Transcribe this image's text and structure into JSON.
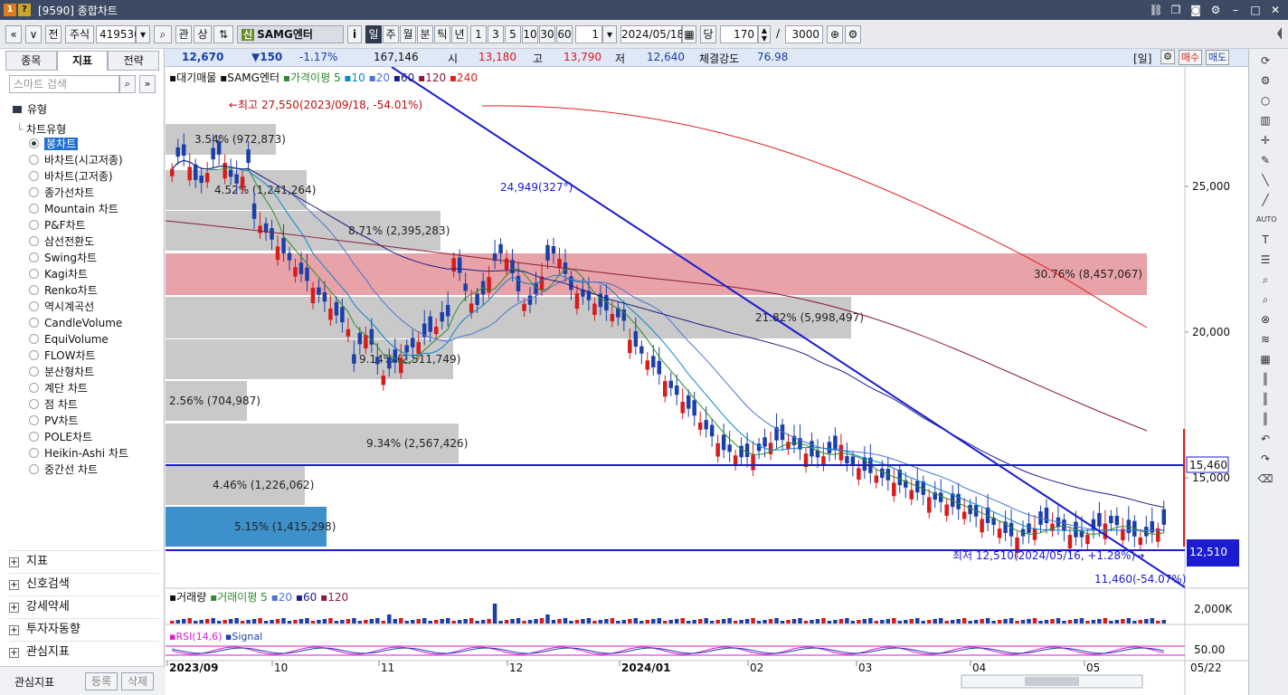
{
  "window": {
    "title": "[9590] 종합차트",
    "icons": [
      "settings-icon",
      "help-icon"
    ]
  },
  "toolbar": {
    "market": "주식",
    "code": "419530",
    "kwan": "관",
    "sang": "상",
    "name_badge": "신",
    "name": "SAMG엔터",
    "info": "i",
    "periods": [
      "일",
      "주",
      "월",
      "분",
      "틱",
      "년"
    ],
    "active_period": "일",
    "intervals": [
      "1",
      "3",
      "5",
      "10",
      "30",
      "60"
    ],
    "unit": "1",
    "date": "2024/05/18",
    "count_label": "당",
    "count": "170",
    "slash": "/",
    "total": "3000",
    "jeon": "전"
  },
  "left": {
    "tabs": [
      "종목",
      "지표",
      "전략"
    ],
    "active_tab": "지표",
    "search_placeholder": "스마트 검색",
    "tree_root": "유형",
    "tree_sub": "차트유형",
    "chart_types": [
      "봉차트",
      "바차트(시고저종)",
      "바차트(고저종)",
      "종가선차트",
      "Mountain 차트",
      "P&F차트",
      "삼선전환도",
      "Swing차트",
      "Kagi차트",
      "Renko차트",
      "역시계곡선",
      "CandleVolume",
      "EquiVolume",
      "FLOW차트",
      "분산형차트",
      "계단 차트",
      "점 차트",
      "PV차트",
      "POLE차트",
      "Heikin-Ashi 차트",
      "중간선 차트"
    ],
    "selected": "봉차트",
    "sections": [
      "지표",
      "신호검색",
      "강세약세",
      "투자자동향",
      "관심지표"
    ],
    "footer": {
      "label": "관심지표",
      "register": "등록",
      "delete": "삭제"
    }
  },
  "pricebar": {
    "price": "12,670",
    "change": "▼150",
    "pct": "-1.17%",
    "volume": "167,146",
    "open_label": "시",
    "open": "13,180",
    "high_label": "고",
    "high": "13,790",
    "low_label": "저",
    "low": "12,640",
    "strength_label": "체결강도",
    "strength": "76.98",
    "period_tag": "[일]",
    "buy": "매수",
    "sell": "매도"
  },
  "chart": {
    "legend": {
      "vp": "대기매물",
      "name": "SAMG엔터",
      "ma_label": "가격이평",
      "ma": [
        "5",
        "10",
        "20",
        "60",
        "120",
        "240"
      ]
    },
    "annotations": {
      "high": "←최고 27,550(2023/09/18, -54.01%)",
      "point": "24,949(327°)",
      "low": "최저 12,510(2024/05/16, +1.28%)→",
      "target": "11,460(-54.07%)"
    },
    "volume_profile": [
      {
        "label": "3.54% (972,873)"
      },
      {
        "label": "4.52% (1,241,264)"
      },
      {
        "label": "8.71% (2,395,283)"
      },
      {
        "label": "30.76% (8,457,067)"
      },
      {
        "label": "21.82% (5,998,497)"
      },
      {
        "label": "9.14% (2,511,749)"
      },
      {
        "label": "2.56% (704,987)"
      },
      {
        "label": "9.34% (2,567,426)"
      },
      {
        "label": "4.46% (1,226,062)"
      },
      {
        "label": "5.15% (1,415,298)"
      }
    ],
    "price_axis": [
      "25,000",
      "20,000",
      "15,000"
    ],
    "hline1": "15,460",
    "hline2": "12,510",
    "volume_legend": {
      "label": "거래량",
      "ma_label": "거래이평",
      "ma": [
        "5",
        "20",
        "60",
        "120"
      ]
    },
    "volume_axis": "2,000K",
    "rsi_legend": {
      "label": "RSI(14,6)",
      "signal": "Signal"
    },
    "rsi_axis": "50.00",
    "date_axis": [
      "2023/09",
      "10",
      "11",
      "12",
      "2024/01",
      "02",
      "03",
      "04",
      "05"
    ],
    "date_right": "05/22"
  }
}
